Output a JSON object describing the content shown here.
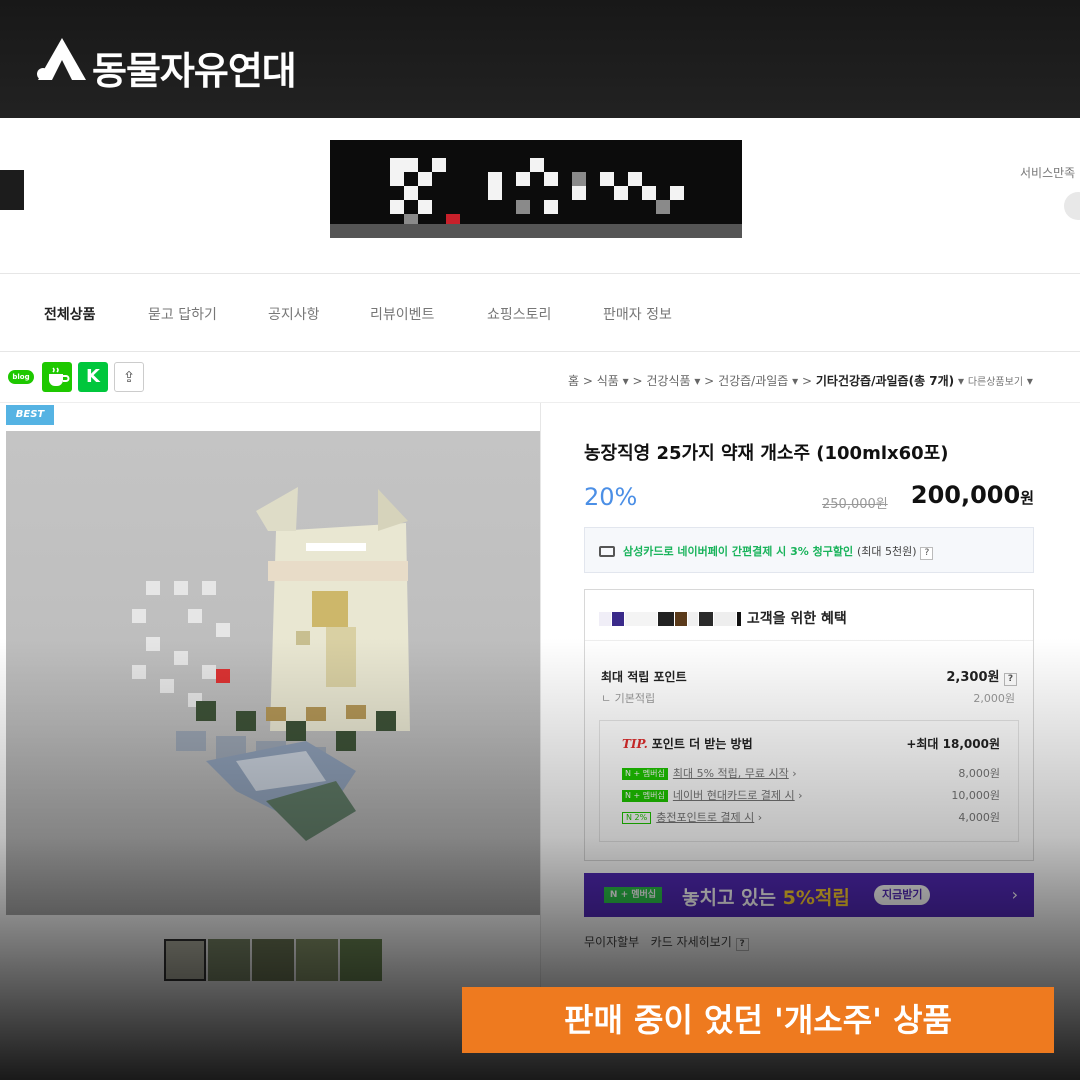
{
  "brand": {
    "name": "동물자유연대",
    "logo_icon": "triangle-logo-icon"
  },
  "store": {
    "logo_note": "pixelated-store-logo",
    "service_text": "서비스만족"
  },
  "nav": {
    "items": [
      "전체상품",
      "묻고 답하기",
      "공지사항",
      "리뷰이벤트",
      "쇼핑스토리",
      "판매자 정보"
    ],
    "active": "전체상품"
  },
  "share": {
    "blog": "blog",
    "k": "K",
    "share_icon": "share-icon"
  },
  "breadcrumb": {
    "items": [
      "홈",
      "식품",
      "건강식품",
      "건강즙/과일즙"
    ],
    "current": "기타건강즙/과일즙(총 7개)",
    "more": "다른상품보기"
  },
  "product": {
    "best": "BEST",
    "title": "농장직영 25가지 약재 개소주 (100mlx60포)",
    "discount": "20%",
    "original_price": "250,000원",
    "price_value": "200,000",
    "price_unit": "원"
  },
  "card_promo": {
    "text": "삼성카드로 네이버페이 간편결제 시 3% 청구할인",
    "sub": "(최대 5천원)",
    "help": "?"
  },
  "benefit": {
    "heading": "고객을 위한 혜택",
    "max_points_label": "최대 적립 포인트",
    "max_points_value": "2,300원",
    "help": "?",
    "basic_label": "ㄴ 기본적립",
    "basic_value": "2,000원",
    "tip_label": "TIP.",
    "tip_title": "포인트 더 받는 방법",
    "tip_max": "+최대 18,000원",
    "tip_rows": [
      {
        "badge": "N + 멤버십",
        "text": "최대 5% 적립, 무료 시작",
        "value": "8,000원"
      },
      {
        "badge": "N + 멤버십",
        "text": "네이버 현대카드로 결제 시",
        "value": "10,000원"
      },
      {
        "badge": "N 2%",
        "text": "충전포인트로 결제 시",
        "value": "4,000원"
      }
    ]
  },
  "membership": {
    "badge": "N + 멤버십",
    "text_a": "놓치고 있는 ",
    "text_b": "5%적립",
    "button": "지금받기",
    "chevron": "›"
  },
  "installment": {
    "a": "무이자할부",
    "b": "카드 자세히보기",
    "help": "?"
  },
  "caption": "판매 중이 었던 '개소주' 상품",
  "colors": {
    "accent": "#ee7a1f",
    "naver_green": "#1ec800",
    "membership_purple": "#5229b8",
    "discount_blue": "#4b8fe6"
  }
}
